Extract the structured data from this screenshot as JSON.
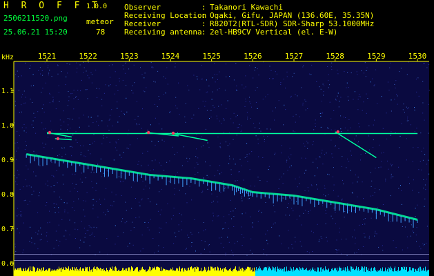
{
  "header": {
    "app_name": "H R O F F T",
    "version": "1.0.0",
    "filename": "2506211520.png",
    "datetime": "25.06.21 15:20",
    "meteor_label": "meteor",
    "meteor_count": "78",
    "info_rows": [
      {
        "key": "Observer",
        "sep": ":",
        "value": "Takanori Kawachi"
      },
      {
        "key": "Receiving Location",
        "sep": ":",
        "value": "Ogaki, Gifu, JAPAN (136.60E, 35.35N)"
      },
      {
        "key": "Receiver",
        "sep": ":",
        "value": "R820T2(RTL-SDR) SDR-Sharp 53.1000MHz"
      },
      {
        "key": "Receiving antenna",
        "sep": ":",
        "value": "2el-HB9CV Vertical (el. E-W)"
      }
    ]
  },
  "chart_data": {
    "type": "heatmap",
    "ylabel": "kHz",
    "x_ticks": [
      "1521",
      "1522",
      "1523",
      "1524",
      "1525",
      "1526",
      "1527",
      "1528",
      "1529",
      "1530"
    ],
    "y_ticks": [
      "1.1",
      "1.0",
      "0.9",
      "0.8",
      "0.7",
      "0.6"
    ],
    "ylim": [
      0.6,
      1.15
    ],
    "xlim": [
      1520.5,
      1530
    ],
    "colors": {
      "axis": "#ffff00",
      "text": "#00ff3c",
      "background": "#0a0a40",
      "signal": "#00ffa0",
      "meteor": "#ff4060"
    },
    "carrier_khz": 0.975,
    "carrier_x_range": [
      1521.0,
      1530.0
    ],
    "drift_trace": [
      {
        "x": 1520.5,
        "y": 0.915
      },
      {
        "x": 1521.5,
        "y": 0.895
      },
      {
        "x": 1522.5,
        "y": 0.875
      },
      {
        "x": 1523.5,
        "y": 0.855
      },
      {
        "x": 1524.5,
        "y": 0.845
      },
      {
        "x": 1525.5,
        "y": 0.825
      },
      {
        "x": 1526.0,
        "y": 0.805
      },
      {
        "x": 1527.0,
        "y": 0.795
      },
      {
        "x": 1528.0,
        "y": 0.775
      },
      {
        "x": 1529.0,
        "y": 0.755
      },
      {
        "x": 1530.0,
        "y": 0.725
      }
    ],
    "meteor_echoes": [
      {
        "x0": 1521.0,
        "y0": 0.978,
        "x1": 1521.6,
        "y1": 0.965
      },
      {
        "x0": 1523.4,
        "y0": 0.978,
        "x1": 1524.2,
        "y1": 0.968
      },
      {
        "x0": 1524.0,
        "y0": 0.976,
        "x1": 1524.9,
        "y1": 0.955
      },
      {
        "x0": 1528.0,
        "y0": 0.98,
        "x1": 1529.0,
        "y1": 0.905
      },
      {
        "x0": 1521.2,
        "y0": 0.96,
        "x1": 1521.6,
        "y1": 0.957
      }
    ],
    "lower_band": [
      0.595,
      0.625
    ]
  }
}
